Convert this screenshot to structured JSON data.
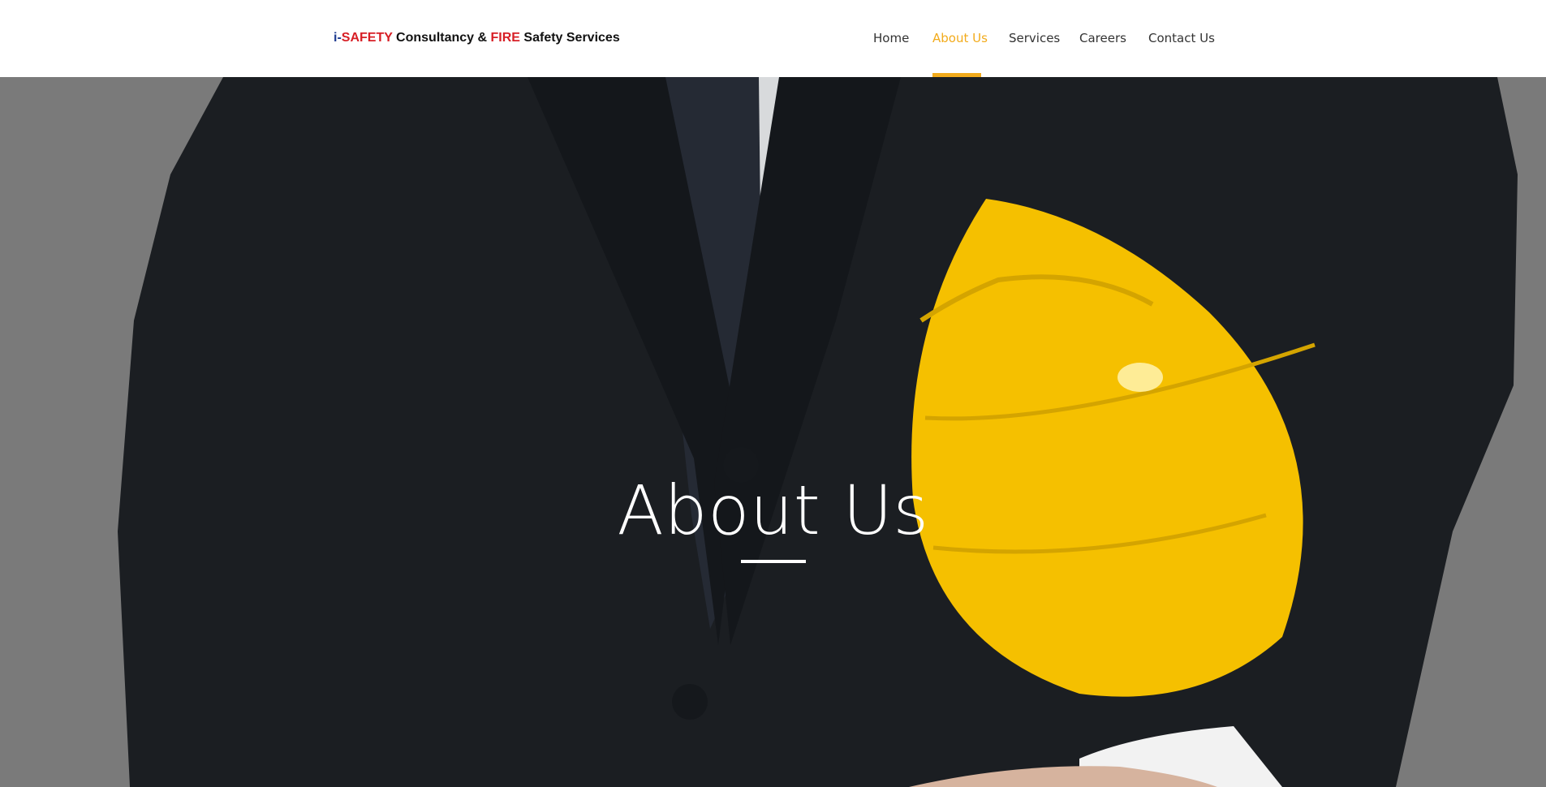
{
  "brand": {
    "prefix": "i-",
    "safety": "SAFETY",
    "middle": " Consultancy & ",
    "fire": "FIRE",
    "suffix": " Safety Services"
  },
  "nav": {
    "items": [
      {
        "label": "Home"
      },
      {
        "label": "About Us",
        "active": true
      },
      {
        "label": "Services"
      },
      {
        "label": "Careers"
      },
      {
        "label": "Contact Us"
      }
    ],
    "accent": "#f2ab1c"
  },
  "hero": {
    "title": "About Us",
    "image": "man-in-suit-holding-yellow-hard-hat"
  },
  "colors": {
    "background": "#7a7a7a",
    "suit": "#1b1e22",
    "helmet": "#f5c000",
    "logo_red": "#d71f26",
    "logo_blue": "#1c3a8f"
  }
}
